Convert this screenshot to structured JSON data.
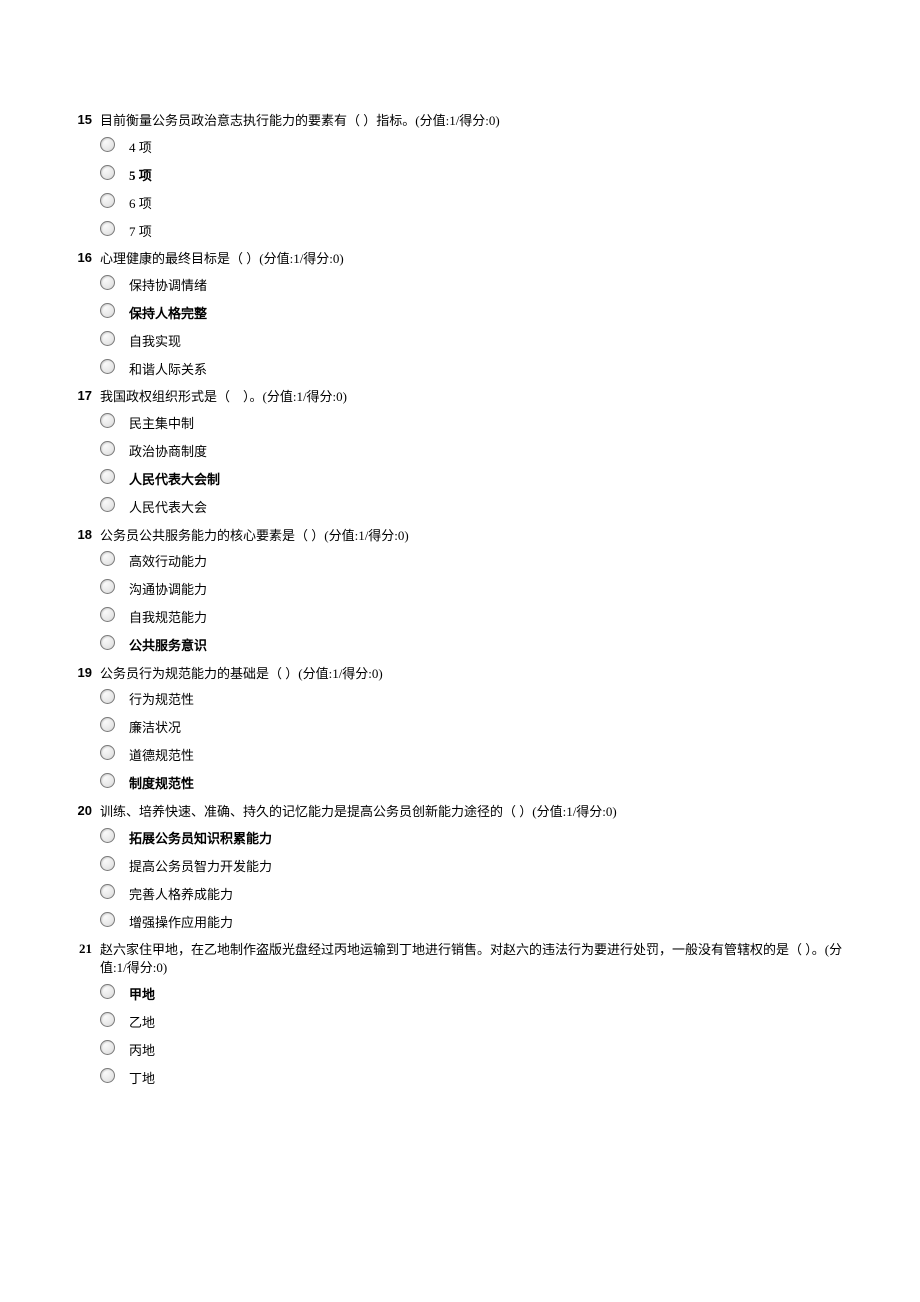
{
  "questions": [
    {
      "num": "15",
      "numStyle": "arial",
      "text": "目前衡量公务员政治意志执行能力的要素有（ ）指标。(分值:1/得分:0)",
      "options": [
        {
          "label": "4 项",
          "bold": false
        },
        {
          "label": "5 项",
          "bold": true
        },
        {
          "label": "6 项",
          "bold": false
        },
        {
          "label": "7 项",
          "bold": false
        }
      ]
    },
    {
      "num": "16",
      "numStyle": "arial",
      "text": "心理健康的最终目标是（ ）(分值:1/得分:0)",
      "options": [
        {
          "label": "保持协调情绪",
          "bold": false
        },
        {
          "label": "保持人格完整",
          "bold": true
        },
        {
          "label": "自我实现",
          "bold": false
        },
        {
          "label": "和谐人际关系",
          "bold": false
        }
      ]
    },
    {
      "num": "17",
      "numStyle": "arial",
      "text": "我国政权组织形式是（　）。(分值:1/得分:0)",
      "options": [
        {
          "label": "民主集中制",
          "bold": false
        },
        {
          "label": "政治协商制度",
          "bold": false
        },
        {
          "label": "人民代表大会制",
          "bold": true
        },
        {
          "label": "人民代表大会",
          "bold": false
        }
      ]
    },
    {
      "num": "18",
      "numStyle": "arial",
      "text": "公务员公共服务能力的核心要素是（ ）(分值:1/得分:0)",
      "options": [
        {
          "label": "高效行动能力",
          "bold": false
        },
        {
          "label": "沟通协调能力",
          "bold": false
        },
        {
          "label": "自我规范能力",
          "bold": false
        },
        {
          "label": "公共服务意识",
          "bold": true
        }
      ]
    },
    {
      "num": "19",
      "numStyle": "arial",
      "text": "公务员行为规范能力的基础是（ ）(分值:1/得分:0)",
      "options": [
        {
          "label": "行为规范性",
          "bold": false
        },
        {
          "label": "廉洁状况",
          "bold": false
        },
        {
          "label": "道德规范性",
          "bold": false
        },
        {
          "label": "制度规范性",
          "bold": true
        }
      ]
    },
    {
      "num": "20",
      "numStyle": "arial",
      "text": "训练、培养快速、准确、持久的记忆能力是提高公务员创新能力途径的（ ）(分值:1/得分:0)",
      "options": [
        {
          "label": "拓展公务员知识积累能力",
          "bold": true
        },
        {
          "label": "提高公务员智力开发能力",
          "bold": false
        },
        {
          "label": "完善人格养成能力",
          "bold": false
        },
        {
          "label": "增强操作应用能力",
          "bold": false
        }
      ]
    },
    {
      "num": "21",
      "numStyle": "alt",
      "text": "赵六家住甲地，在乙地制作盗版光盘经过丙地运输到丁地进行销售。对赵六的违法行为要进行处罚，一般没有管辖权的是（ ）。(分值:1/得分:0)",
      "options": [
        {
          "label": "甲地",
          "bold": true
        },
        {
          "label": "乙地",
          "bold": false
        },
        {
          "label": "丙地",
          "bold": false
        },
        {
          "label": "丁地",
          "bold": false
        }
      ]
    }
  ]
}
